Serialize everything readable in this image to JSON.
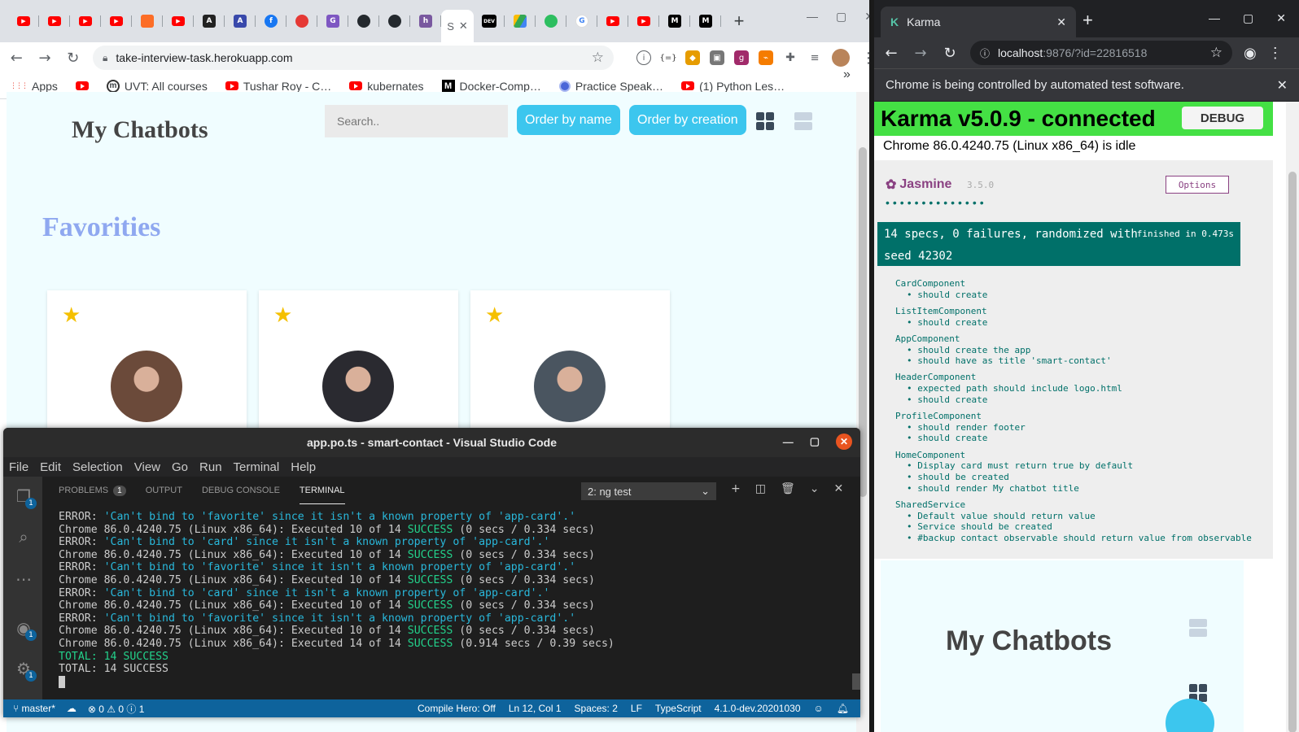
{
  "left_browser": {
    "tabs": [
      {
        "icon": "youtube-icon",
        "color": "#ff0000",
        "glyph": ""
      },
      {
        "icon": "youtube-icon",
        "color": "#ff0000",
        "glyph": ""
      },
      {
        "icon": "youtube-icon",
        "color": "#ff0000",
        "glyph": ""
      },
      {
        "icon": "youtube-icon",
        "color": "#ff0000",
        "glyph": ""
      },
      {
        "icon": "gitlab-icon",
        "color": "#fc6d26",
        "glyph": ""
      },
      {
        "icon": "youtube-icon",
        "color": "#ff0000",
        "glyph": ""
      },
      {
        "icon": "angular-icon",
        "color": "#222222",
        "glyph": "A"
      },
      {
        "icon": "appwrite-icon",
        "color": "#3949ab",
        "glyph": "A"
      },
      {
        "icon": "facebook-icon",
        "color": "#1877f2",
        "glyph": "f"
      },
      {
        "icon": "record-icon",
        "color": "#e53935",
        "glyph": ""
      },
      {
        "icon": "translate-icon",
        "color": "#7e57c2",
        "glyph": "G"
      },
      {
        "icon": "github-icon",
        "color": "#24292e",
        "glyph": ""
      },
      {
        "icon": "github-icon",
        "color": "#24292e",
        "glyph": ""
      },
      {
        "icon": "heroku-icon",
        "color": "#79589f",
        "glyph": "h"
      }
    ],
    "active_tab": {
      "label": "S",
      "close": "✕"
    },
    "tabs_after": [
      {
        "icon": "dev-icon",
        "color": "#000000",
        "glyph": "DEV"
      },
      {
        "icon": "drive-icon",
        "color": "#1fa463",
        "glyph": ""
      },
      {
        "icon": "evernote-icon",
        "color": "#2dbe60",
        "glyph": ""
      },
      {
        "icon": "google-icon",
        "color": "#4285f4",
        "glyph": "G"
      },
      {
        "icon": "youtube-icon",
        "color": "#ff0000",
        "glyph": ""
      },
      {
        "icon": "youtube-icon",
        "color": "#ff0000",
        "glyph": ""
      },
      {
        "icon": "medium-icon",
        "color": "#000000",
        "glyph": "M"
      },
      {
        "icon": "medium-icon",
        "color": "#000000",
        "glyph": "M"
      }
    ],
    "new_tab": "+",
    "url": "take-interview-task.herokuapp.com",
    "bookmarks": [
      {
        "label": "Apps",
        "kind": "apps"
      },
      {
        "label": "",
        "kind": "yt"
      },
      {
        "label": "UVT: All courses",
        "kind": "uvt"
      },
      {
        "label": "Tushar Roy - C…",
        "kind": "yt"
      },
      {
        "label": "kubernates",
        "kind": "yt"
      },
      {
        "label": "Docker-Comp…",
        "kind": "medium"
      },
      {
        "label": "Practice Speak…",
        "kind": "globe"
      },
      {
        "label": "(1) Python Les…",
        "kind": "yt"
      }
    ],
    "bookmarks_more": "»",
    "app": {
      "title": "My Chatbots",
      "search_placeholder": "Search..",
      "order_by_name": "Order by name",
      "order_by_creation": "Order by creation",
      "favorites_heading": "Favorities",
      "cards": [
        {
          "favorite": true,
          "avatar_color": "#6b4a3a"
        },
        {
          "favorite": true,
          "avatar_color": "#2a2a30"
        },
        {
          "favorite": true,
          "avatar_color": "#4a5560"
        }
      ]
    }
  },
  "vscode": {
    "title": "app.po.ts - smart-contact - Visual Studio Code",
    "menu": [
      "File",
      "Edit",
      "Selection",
      "View",
      "Go",
      "Run",
      "Terminal",
      "Help"
    ],
    "panel_tabs": [
      {
        "label": "PROBLEMS",
        "count": "1"
      },
      {
        "label": "OUTPUT"
      },
      {
        "label": "DEBUG CONSOLE"
      },
      {
        "label": "TERMINAL",
        "active": true
      }
    ],
    "terminal_select": "2: ng test",
    "terminal_lines": [
      {
        "type": "error",
        "prefix": "ERROR: ",
        "msg": "'Can't bind to 'favorite' since it isn't a known property of 'app-card'.'"
      },
      {
        "type": "exec",
        "pre": "Chrome 86.0.4240.75 (Linux x86_64): Executed 10 of 14 ",
        "status": "SUCCESS",
        "post": " (0 secs / 0.334 secs)"
      },
      {
        "type": "error",
        "prefix": "ERROR: ",
        "msg": "'Can't bind to 'card' since it isn't a known property of 'app-card'.'"
      },
      {
        "type": "exec",
        "pre": "Chrome 86.0.4240.75 (Linux x86_64): Executed 10 of 14 ",
        "status": "SUCCESS",
        "post": " (0 secs / 0.334 secs)"
      },
      {
        "type": "error",
        "prefix": "ERROR: ",
        "msg": "'Can't bind to 'favorite' since it isn't a known property of 'app-card'.'"
      },
      {
        "type": "exec",
        "pre": "Chrome 86.0.4240.75 (Linux x86_64): Executed 10 of 14 ",
        "status": "SUCCESS",
        "post": " (0 secs / 0.334 secs)"
      },
      {
        "type": "error",
        "prefix": "ERROR: ",
        "msg": "'Can't bind to 'card' since it isn't a known property of 'app-card'.'"
      },
      {
        "type": "exec",
        "pre": "Chrome 86.0.4240.75 (Linux x86_64): Executed 10 of 14 ",
        "status": "SUCCESS",
        "post": " (0 secs / 0.334 secs)"
      },
      {
        "type": "error",
        "prefix": "ERROR: ",
        "msg": "'Can't bind to 'favorite' since it isn't a known property of 'app-card'.'"
      },
      {
        "type": "exec",
        "pre": "Chrome 86.0.4240.75 (Linux x86_64): Executed 10 of 14 ",
        "status": "SUCCESS",
        "post": " (0 secs / 0.334 secs)"
      },
      {
        "type": "exec",
        "pre": "Chrome 86.0.4240.75 (Linux x86_64): Executed 14 of 14 ",
        "status": "SUCCESS",
        "post": " (0.914 secs / 0.39 secs)"
      },
      {
        "type": "total_green",
        "text": "TOTAL: 14 SUCCESS"
      },
      {
        "type": "total_plain",
        "text": "TOTAL: 14 SUCCESS"
      }
    ],
    "status": {
      "branch": "master*",
      "errors": "0",
      "warnings": "0",
      "info": "1",
      "compile_hero": "Compile Hero: Off",
      "position": "Ln 12, Col 1",
      "spaces": "Spaces: 2",
      "eol": "LF",
      "language": "TypeScript",
      "ts_version": "4.1.0-dev.20201030"
    }
  },
  "karma_browser": {
    "tab_title": "Karma",
    "url_host": "localhost",
    "url_rest": ":9876/?id=22816518",
    "infobar": "Chrome is being controlled by automated test software.",
    "banner": "Karma v5.0.9 - connected",
    "debug_button": "DEBUG",
    "browser_status": "Chrome 86.0.4240.75 (Linux x86_64) is idle",
    "jasmine": {
      "name": "Jasmine",
      "version": "3.5.0",
      "options": "Options",
      "dots": "••••••••••••••",
      "summary_line1": "14 specs, 0 failures, randomized with",
      "summary_line2": "seed 42302",
      "finished": "finished in 0.473s",
      "suites": [
        {
          "name": "CardComponent",
          "specs": [
            "should create"
          ]
        },
        {
          "name": "ListItemComponent",
          "specs": [
            "should create"
          ]
        },
        {
          "name": "AppComponent",
          "specs": [
            "should create the app",
            "should have as title 'smart-contact'"
          ]
        },
        {
          "name": "HeaderComponent",
          "specs": [
            "expected path should include logo.html",
            "should create"
          ]
        },
        {
          "name": "ProfileComponent",
          "specs": [
            "should render footer",
            "should create"
          ]
        },
        {
          "name": "HomeComponent",
          "specs": [
            "Display card must return true by default",
            "should be created",
            "should render My chatbot title"
          ]
        },
        {
          "name": "SharedService",
          "specs": [
            "Default value should return value",
            "Service should be created",
            "#backup contact observable should return value from observable"
          ]
        }
      ]
    },
    "app_title": "My Chatbots"
  }
}
